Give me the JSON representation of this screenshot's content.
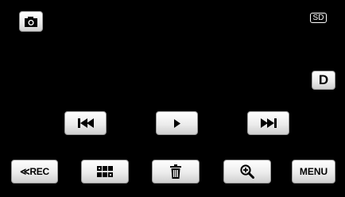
{
  "top_bar": {
    "mode_icon": "camera-icon",
    "sd_label": "SD"
  },
  "side": {
    "delete_check_label": "D"
  },
  "playback": {
    "prev_icon": "skip-previous-icon",
    "play_icon": "play-icon",
    "next_icon": "skip-next-icon"
  },
  "bottom_bar": {
    "rec_label": "≪REC",
    "index_icon": "index-grid-icon",
    "trash_icon": "trash-icon",
    "zoom_icon": "zoom-in-icon",
    "menu_label": "MENU"
  },
  "colors": {
    "background": "#000000",
    "button_face": "#ececec",
    "icon": "#000000",
    "indicator": "#ffffff"
  }
}
